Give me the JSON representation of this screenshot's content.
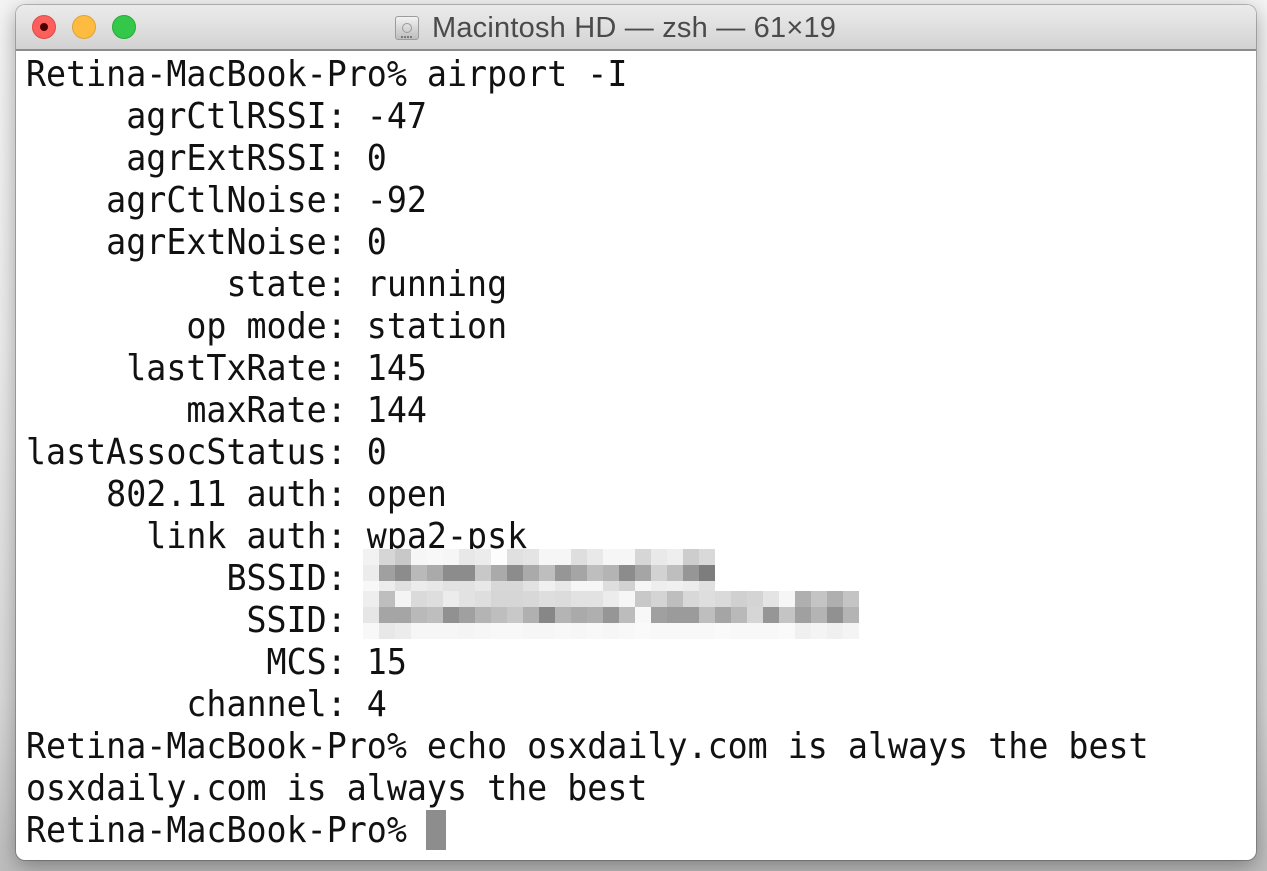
{
  "window": {
    "title": "Macintosh HD — zsh — 61×19",
    "title_icon": "hard-disk-icon",
    "controls": {
      "close": {
        "icon": "close-icon",
        "color": "#fc605c"
      },
      "minimize": {
        "icon": "minimize-icon",
        "color": "#fdbc40"
      },
      "zoom": {
        "icon": "zoom-icon",
        "color": "#34c84a"
      }
    }
  },
  "terminal": {
    "prompt": "Retina-MacBook-Pro%",
    "lines": [
      {
        "kind": "command",
        "text": "Retina-MacBook-Pro% airport -I"
      },
      {
        "kind": "output",
        "key": "agrCtlRSSI",
        "value": "-47",
        "text": "     agrCtlRSSI: -47"
      },
      {
        "kind": "output",
        "key": "agrExtRSSI",
        "value": "0",
        "text": "     agrExtRSSI: 0"
      },
      {
        "kind": "output",
        "key": "agrCtlNoise",
        "value": "-92",
        "text": "    agrCtlNoise: -92"
      },
      {
        "kind": "output",
        "key": "agrExtNoise",
        "value": "0",
        "text": "    agrExtNoise: 0"
      },
      {
        "kind": "output",
        "key": "state",
        "value": "running",
        "text": "          state: running"
      },
      {
        "kind": "output",
        "key": "op mode",
        "value": "station",
        "text": "        op mode: station"
      },
      {
        "kind": "output",
        "key": "lastTxRate",
        "value": "145",
        "text": "     lastTxRate: 145"
      },
      {
        "kind": "output",
        "key": "maxRate",
        "value": "144",
        "text": "        maxRate: 144"
      },
      {
        "kind": "output",
        "key": "lastAssocStatus",
        "value": "0",
        "text": "lastAssocStatus: 0"
      },
      {
        "kind": "output",
        "key": "802.11 auth",
        "value": "open",
        "text": "    802.11 auth: open"
      },
      {
        "kind": "output",
        "key": "link auth",
        "value": "wpa2-psk",
        "text": "      link auth: wpa2-psk"
      },
      {
        "kind": "output",
        "key": "BSSID",
        "value": "[redacted]",
        "redacted": true,
        "text": "          BSSID: "
      },
      {
        "kind": "output",
        "key": "SSID",
        "value": "[redacted]",
        "redacted": true,
        "text": "           SSID: "
      },
      {
        "kind": "output",
        "key": "MCS",
        "value": "15",
        "text": "            MCS: 15"
      },
      {
        "kind": "output",
        "key": "channel",
        "value": "4",
        "text": "        channel: 4"
      },
      {
        "kind": "command",
        "text": "Retina-MacBook-Pro% echo osxdaily.com is always the best"
      },
      {
        "kind": "output",
        "text": "osxdaily.com is always the best"
      },
      {
        "kind": "prompt",
        "text": "Retina-MacBook-Pro% "
      }
    ],
    "cursor": {
      "line": 18,
      "column": 20,
      "color": "#8d8d8d"
    },
    "redaction_mosaic": {
      "bssid_shades": [
        [
          242,
          214,
          200,
          246,
          248,
          246,
          232,
          236,
          253,
          224,
          228,
          246,
          246,
          222,
          233,
          246,
          246,
          214,
          233,
          238,
          205,
          217
        ],
        [
          236,
          160,
          140,
          185,
          170,
          140,
          140,
          200,
          170,
          140,
          170,
          190,
          150,
          165,
          190,
          180,
          140,
          165,
          210,
          190,
          150,
          125
        ],
        [
          248,
          236,
          224,
          236,
          232,
          226,
          226,
          232,
          216,
          216,
          226,
          240,
          232,
          246,
          246,
          222,
          210,
          246,
          238,
          240,
          236,
          224
        ]
      ],
      "ssid_shades": [
        [
          238,
          190,
          244,
          218,
          222,
          236,
          226,
          222,
          214,
          214,
          216,
          222,
          220,
          226,
          226,
          236,
          246,
          200,
          212,
          190,
          216,
          222,
          218,
          208,
          212,
          228,
          246,
          175,
          196,
          175,
          196
        ],
        [
          230,
          165,
          165,
          185,
          190,
          145,
          160,
          180,
          190,
          200,
          176,
          135,
          180,
          170,
          175,
          150,
          188,
          248,
          160,
          155,
          155,
          190,
          165,
          185,
          214,
          150,
          196,
          160,
          180,
          145,
          180
        ],
        [
          248,
          232,
          236,
          246,
          246,
          246,
          244,
          246,
          248,
          248,
          246,
          246,
          248,
          246,
          248,
          246,
          248,
          250,
          248,
          248,
          248,
          248,
          250,
          248,
          248,
          248,
          250,
          240,
          244,
          240,
          244
        ]
      ]
    }
  }
}
